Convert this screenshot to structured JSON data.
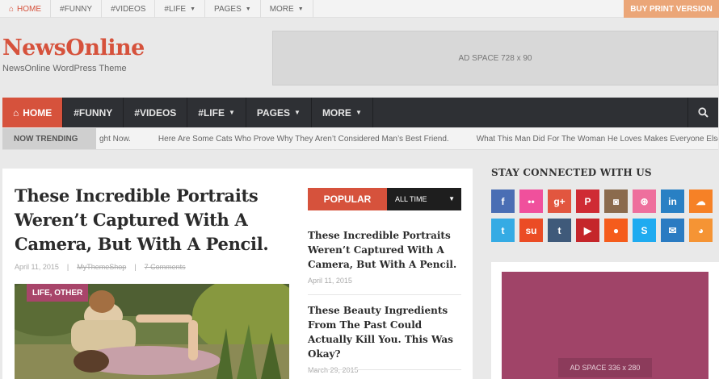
{
  "topbar": {
    "items": [
      {
        "label": "HOME",
        "icon": "home-icon",
        "active": true
      },
      {
        "label": "#FUNNY"
      },
      {
        "label": "#VIDEOS"
      },
      {
        "label": "#LIFE",
        "dropdown": true
      },
      {
        "label": "PAGES",
        "dropdown": true
      },
      {
        "label": "MORE",
        "dropdown": true
      }
    ],
    "cta_label": "BUY PRINT VERSION"
  },
  "header": {
    "logo": "NewsOnline",
    "tagline": "NewsOnline WordPress Theme",
    "ad_label": "AD SPACE 728 x 90"
  },
  "mainnav": {
    "items": [
      {
        "label": "HOME",
        "icon": "home-icon",
        "active": true
      },
      {
        "label": "#FUNNY"
      },
      {
        "label": "#VIDEOS"
      },
      {
        "label": "#LIFE",
        "dropdown": true
      },
      {
        "label": "PAGES",
        "dropdown": true
      },
      {
        "label": "MORE",
        "dropdown": true
      }
    ]
  },
  "trending": {
    "label": "NOW TRENDING",
    "items": [
      "ght Now.",
      "Here Are Some Cats Who Prove Why They Aren’t Considered Man’s Best Friend.",
      "What This Man Did For The Woman He Loves Makes Everyone Else Look Ba"
    ]
  },
  "post": {
    "title": "These Incredible Portraits Weren’t Captured With A Camera, But With A Pencil.",
    "date": "April 11, 2015",
    "author": "MyThemeShop",
    "comments": "7 Comments",
    "category": "LIFE, OTHER"
  },
  "popular": {
    "tab_label": "POPULAR",
    "range_label": "ALL TIME",
    "items": [
      {
        "title": "These Incredible Portraits Weren’t Captured With A Camera, But With A Pencil.",
        "date": "April 11, 2015"
      },
      {
        "title": "These Beauty Ingredients From The Past Could Actually Kill You. This Was Okay?",
        "date": "March 29, 2015"
      }
    ]
  },
  "sidebar": {
    "stay_title": "STAY CONNECTED WITH US",
    "socials": [
      {
        "name": "facebook-icon",
        "glyph": "f",
        "color": "#4a6eb4"
      },
      {
        "name": "flickr-icon",
        "glyph": "••",
        "color": "#f0509c"
      },
      {
        "name": "google-plus-icon",
        "glyph": "g+",
        "color": "#e2563f"
      },
      {
        "name": "pinterest-icon",
        "glyph": "P",
        "color": "#cf2b34"
      },
      {
        "name": "instagram-icon",
        "glyph": "◙",
        "color": "#8b6b4d"
      },
      {
        "name": "dribbble-icon",
        "glyph": "⊛",
        "color": "#ee6f9d"
      },
      {
        "name": "linkedin-icon",
        "glyph": "in",
        "color": "#2980c4"
      },
      {
        "name": "soundcloud-icon",
        "glyph": "☁",
        "color": "#f68126"
      },
      {
        "name": "twitter-icon",
        "glyph": "t",
        "color": "#35abe4"
      },
      {
        "name": "stumbleupon-icon",
        "glyph": "su",
        "color": "#eb4c25"
      },
      {
        "name": "tumblr-icon",
        "glyph": "t",
        "color": "#3f5a7a"
      },
      {
        "name": "youtube-icon",
        "glyph": "▶",
        "color": "#c5262b"
      },
      {
        "name": "reddit-icon",
        "glyph": "●",
        "color": "#f55c1c"
      },
      {
        "name": "skype-icon",
        "glyph": "S",
        "color": "#1fabf0"
      },
      {
        "name": "email-icon",
        "glyph": "✉",
        "color": "#2a7bc2"
      },
      {
        "name": "rss-icon",
        "glyph": "◕",
        "color": "#f59434"
      }
    ],
    "ad_label": "AD SPACE 336 x 280"
  },
  "colors": {
    "accent": "#d6523c",
    "nav_bg": "#2e3034",
    "badge": "#a8456a",
    "sidebar_ad": "#a04468"
  }
}
